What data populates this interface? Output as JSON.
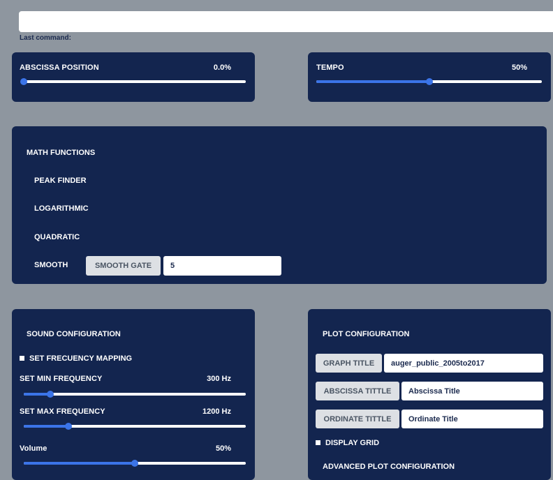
{
  "command": {
    "value": "",
    "label": "Last command:"
  },
  "abscissa": {
    "label": "ABSCISSA POSITION",
    "value_text": "0.0%",
    "value": 0.0
  },
  "tempo": {
    "label": "TEMPO",
    "value_text": "50%",
    "value": 0.5
  },
  "math": {
    "title": "MATH FUNCTIONS",
    "items": [
      "PEAK FINDER",
      "LOGARITHMIC",
      "QUADRATIC",
      "SMOOTH"
    ],
    "smooth_gate_label": "SMOOTH GATE",
    "smooth_gate_value": "5"
  },
  "sound": {
    "title": "SOUND CONFIGURATION",
    "mapping_label": "SET FRECUENCY MAPPING",
    "min_label": "SET MIN FREQUENCY",
    "min_value_text": "300 Hz",
    "min_value": 0.12,
    "max_label": "SET MAX FREQUENCY",
    "max_value_text": "1200 Hz",
    "max_value": 0.2,
    "volume_label": "Volume",
    "volume_value_text": "50%",
    "volume_value": 0.5
  },
  "plot": {
    "title": "PLOT CONFIGURATION",
    "graph_title_label": "GRAPH TITLE",
    "graph_title_value": "auger_public_2005to2017",
    "abscissa_label": "ABSCISSA TITTLE",
    "abscissa_value": "Abscissa Title",
    "ordinate_label": "ORDINATE TITTLE",
    "ordinate_value": "Ordinate Title",
    "grid_label": "DISPLAY GRID",
    "advanced_label": "ADVANCED PLOT CONFIGURATION"
  },
  "colors": {
    "panel": "#13254f",
    "accent": "#3b74e8",
    "background": "#8e969f"
  }
}
